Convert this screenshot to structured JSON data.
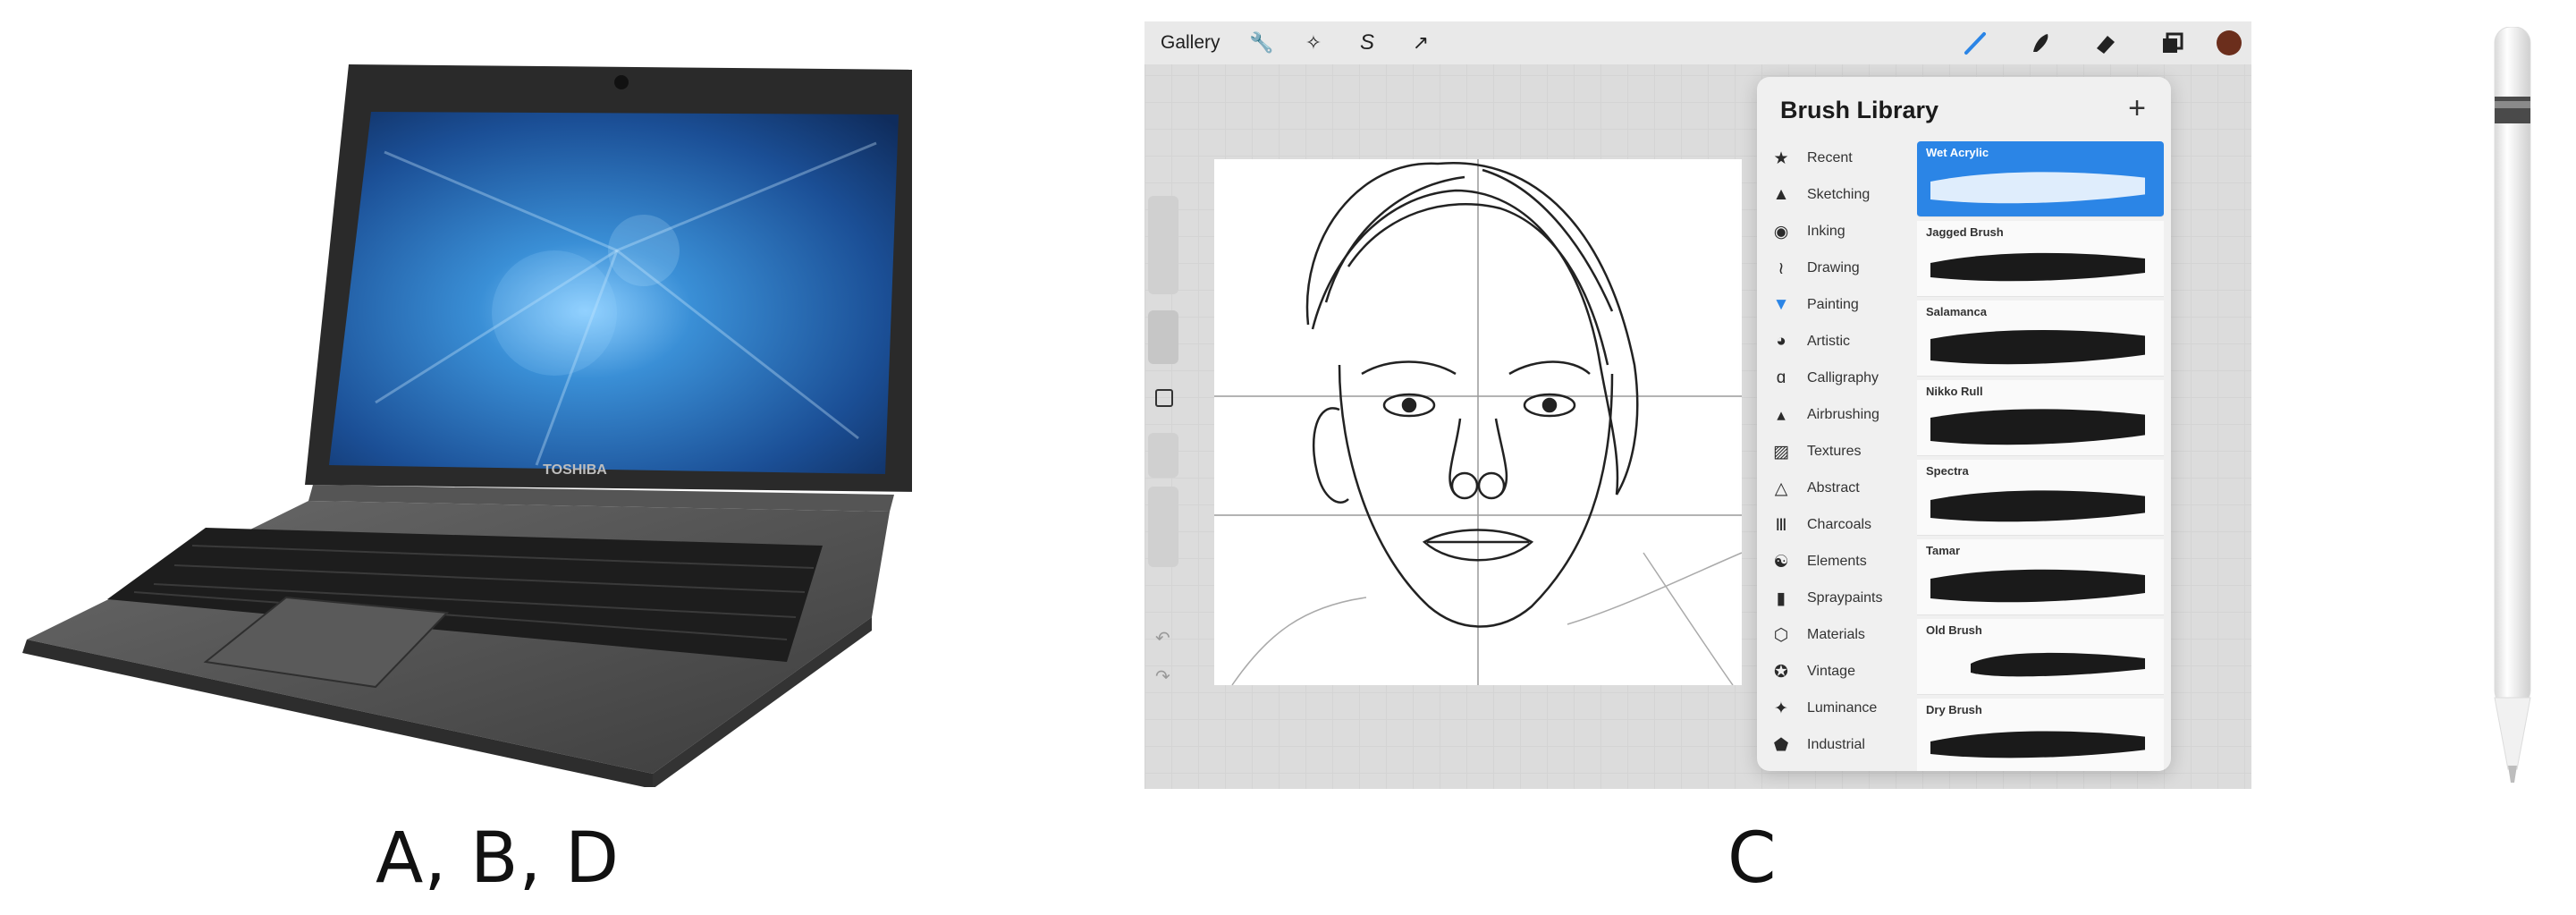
{
  "captions": {
    "left": "A, B, D",
    "middle": "C"
  },
  "laptop": {
    "brand": "TOSHIBA"
  },
  "procreate": {
    "gallery_label": "Gallery",
    "panel_title": "Brush Library",
    "add_symbol": "+",
    "categories": [
      {
        "label": "Recent",
        "icon": "star-icon"
      },
      {
        "label": "Sketching",
        "icon": "pencil-tip-icon"
      },
      {
        "label": "Inking",
        "icon": "ink-drop-icon"
      },
      {
        "label": "Drawing",
        "icon": "squiggle-icon"
      },
      {
        "label": "Painting",
        "icon": "paint-brush-icon"
      },
      {
        "label": "Artistic",
        "icon": "palette-icon"
      },
      {
        "label": "Calligraphy",
        "icon": "calligraphy-icon"
      },
      {
        "label": "Airbrushing",
        "icon": "airbrush-icon"
      },
      {
        "label": "Textures",
        "icon": "texture-icon"
      },
      {
        "label": "Abstract",
        "icon": "triangle-icon"
      },
      {
        "label": "Charcoals",
        "icon": "charcoal-icon"
      },
      {
        "label": "Elements",
        "icon": "yin-yang-icon"
      },
      {
        "label": "Spraypaints",
        "icon": "spray-can-icon"
      },
      {
        "label": "Materials",
        "icon": "cube-icon"
      },
      {
        "label": "Vintage",
        "icon": "vintage-star-icon"
      },
      {
        "label": "Luminance",
        "icon": "sparkle-icon"
      },
      {
        "label": "Industrial",
        "icon": "anvil-icon"
      }
    ],
    "brushes": [
      {
        "name": "Wet Acrylic",
        "selected": true
      },
      {
        "name": "Jagged Brush",
        "selected": false
      },
      {
        "name": "Salamanca",
        "selected": false
      },
      {
        "name": "Nikko Rull",
        "selected": false
      },
      {
        "name": "Spectra",
        "selected": false
      },
      {
        "name": "Tamar",
        "selected": false
      },
      {
        "name": "Old Brush",
        "selected": false
      },
      {
        "name": "Dry Brush",
        "selected": false
      }
    ],
    "colors": {
      "accent": "#2b85e6",
      "active_color": "#6b2e1c"
    }
  }
}
